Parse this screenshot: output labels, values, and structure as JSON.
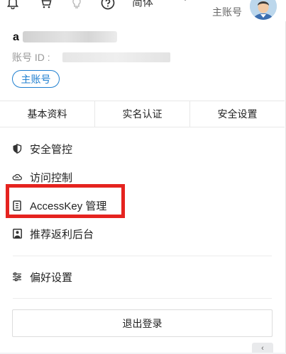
{
  "topbar": {
    "language": "简体",
    "account_label": "主账号"
  },
  "user": {
    "name_initial": "a",
    "account_id_label": "账号 ID :",
    "badge": "主账号"
  },
  "tabs": [
    {
      "label": "基本资料"
    },
    {
      "label": "实名认证"
    },
    {
      "label": "安全设置"
    }
  ],
  "menu": {
    "items": [
      {
        "label": "安全管控",
        "icon": "shield-icon"
      },
      {
        "label": "访问控制",
        "icon": "cloud-icon"
      },
      {
        "label": "AccessKey 管理",
        "icon": "key-card-icon"
      },
      {
        "label": "推荐返利后台",
        "icon": "portrait-icon"
      },
      {
        "label": "偏好设置",
        "icon": "sliders-icon"
      }
    ],
    "logout_label": "退出登录"
  },
  "colors": {
    "accent": "#1f7fd0",
    "highlight": "#e5231f"
  }
}
